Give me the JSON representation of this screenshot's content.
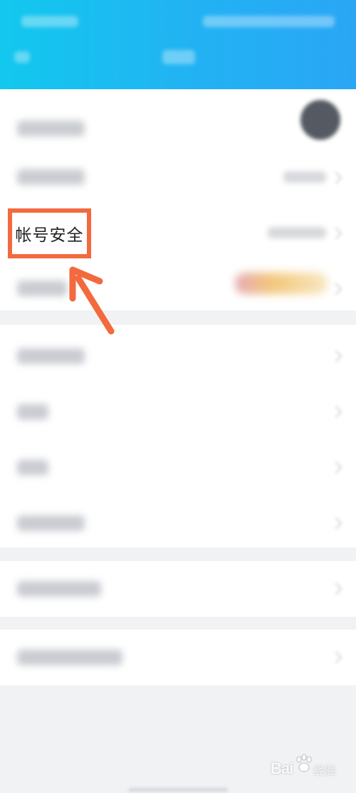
{
  "highlight": {
    "label": "帐号安全"
  },
  "watermark": {
    "brand": "Bai",
    "cn": "经验"
  },
  "colors": {
    "header": "#1ec0f0",
    "highlight_border": "#f26a3d",
    "arrow": "#f26a3d"
  }
}
